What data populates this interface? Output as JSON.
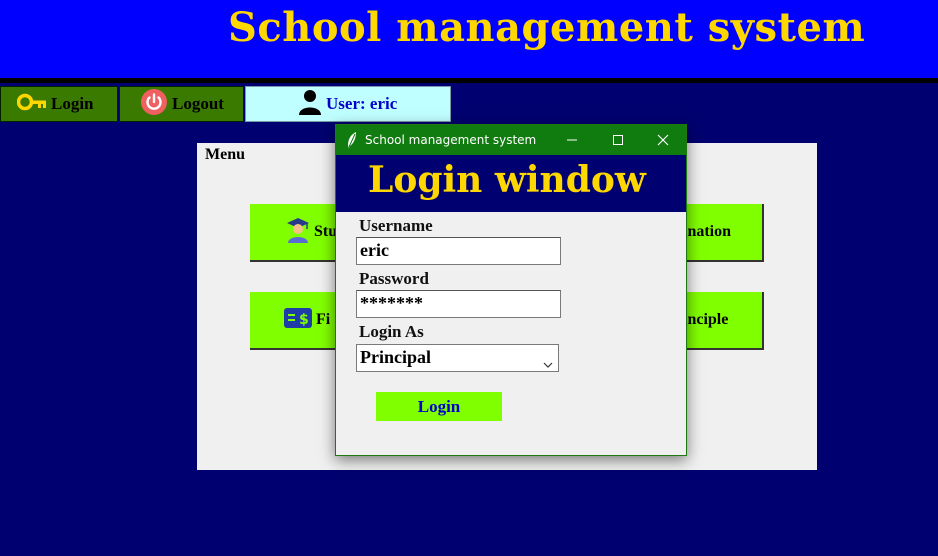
{
  "app": {
    "title": "School management system"
  },
  "topbar": {
    "login_label": "Login",
    "logout_label": "Logout",
    "user_label": "User: eric"
  },
  "menu": {
    "label": "Menu",
    "buttons": [
      {
        "label": "Stu"
      },
      {
        "label": "Fi"
      },
      {
        "label": "ination"
      },
      {
        "label": "inciple"
      }
    ]
  },
  "dialog": {
    "window_title": "School management system",
    "header": "Login window",
    "username_label": "Username",
    "username_value": "eric",
    "password_label": "Password",
    "password_value": "*******",
    "login_as_label": "Login As",
    "login_as_value": "Principal",
    "login_button": "Login"
  },
  "colors": {
    "background": "#000070",
    "title_bar": "#0000ff",
    "title_text": "#ffd700",
    "accent_green": "#80ff00",
    "dialog_titlebar": "#107c10"
  },
  "icons": [
    "key-icon",
    "power-icon",
    "user-icon",
    "graduate-icon",
    "cash-icon",
    "feather-icon",
    "minimize-icon",
    "maximize-icon",
    "close-icon",
    "chevron-down-icon"
  ]
}
